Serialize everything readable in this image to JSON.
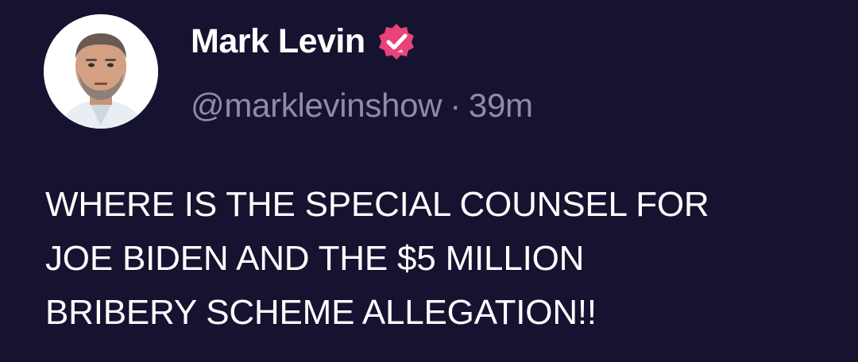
{
  "author": {
    "display_name": "Mark Levin",
    "handle": "@marklevinshow",
    "separator": "·",
    "timestamp": "39m",
    "verified": true,
    "avatar_icon": "profile-photo",
    "verified_icon": "verified-badge-icon"
  },
  "post": {
    "lines": [
      "WHERE IS THE SPECIAL COUNSEL FOR",
      "JOE BIDEN AND THE $5 MILLION",
      "BRIBERY SCHEME ALLEGATION!!"
    ]
  },
  "colors": {
    "background": "#161330",
    "text": "#ffffff",
    "muted": "#8f8ca3",
    "badge": "#e8437a"
  }
}
